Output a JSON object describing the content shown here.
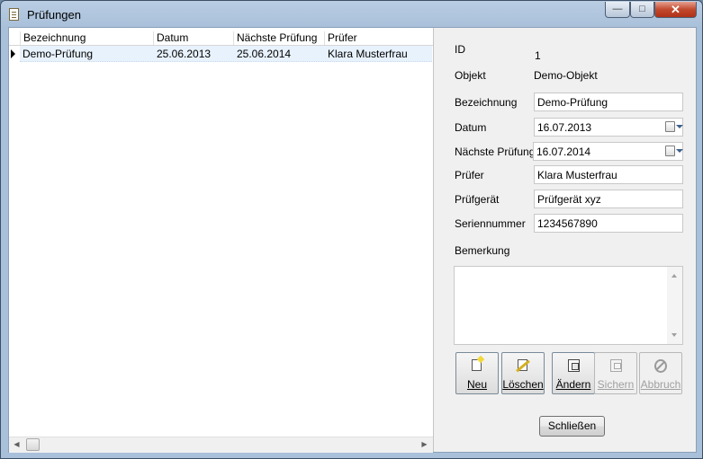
{
  "window": {
    "title": "Prüfungen",
    "controls": {
      "minimize": "—",
      "maximize": "□",
      "close": "✕"
    }
  },
  "list": {
    "columns": [
      "Bezeichnung",
      "Datum",
      "Nächste Prüfung",
      "Prüfer"
    ],
    "rows": [
      {
        "bezeichnung": "Demo-Prüfung",
        "datum": "25.06.2013",
        "naechste": "25.06.2014",
        "pruefer": "Klara Musterfrau"
      }
    ]
  },
  "form": {
    "id_label": "ID",
    "id_value": "1",
    "objekt_label": "Objekt",
    "objekt_value": "Demo-Objekt",
    "bezeichnung_label": "Bezeichnung",
    "bezeichnung_value": "Demo-Prüfung",
    "datum_label": "Datum",
    "datum_value": "16.07.2013",
    "naechste_label": "Nächste Prüfung",
    "naechste_value": "16.07.2014",
    "pruefer_label": "Prüfer",
    "pruefer_value": "Klara Musterfrau",
    "pruefgeraet_label": "Prüfgerät",
    "pruefgeraet_value": "Prüfgerät xyz",
    "seriennummer_label": "Seriennummer",
    "seriennummer_value": "1234567890",
    "bemerkung_label": "Bemerkung",
    "bemerkung_value": ""
  },
  "toolbar": {
    "neu": "Neu",
    "loeschen": "Löschen",
    "aendern": "Ändern",
    "sichern": "Sichern",
    "abbruch": "Abbruch"
  },
  "footer": {
    "schliessen": "Schließen"
  },
  "colors": {
    "window_frame": "#a9c0da",
    "selected_row": "#e8f2fd",
    "close_button": "#c24a2e"
  },
  "icons": [
    "document-icon",
    "new-icon",
    "delete-icon",
    "edit-icon",
    "save-icon",
    "cancel-icon",
    "calendar-icon",
    "dropdown-arrow-icon"
  ]
}
